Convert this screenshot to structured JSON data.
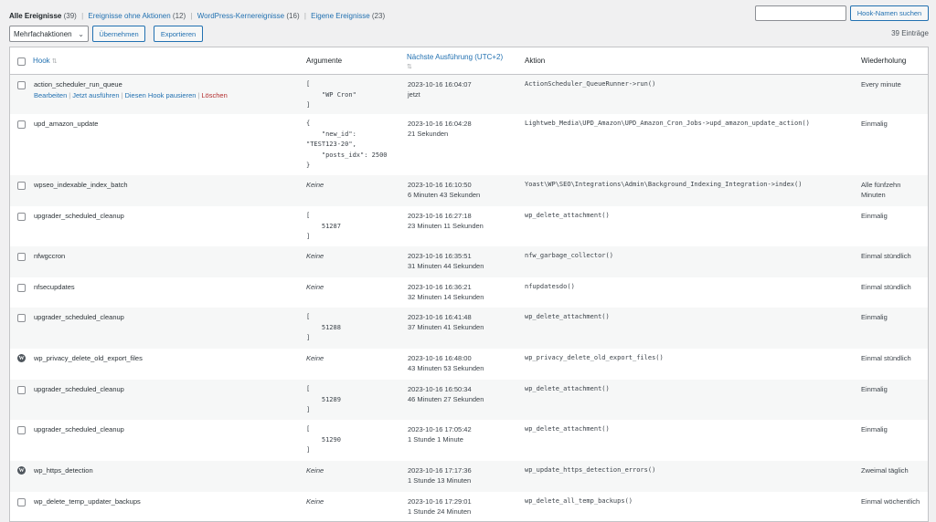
{
  "filters": {
    "all_label": "Alle Ereignisse",
    "all_count": "(39)",
    "noaction_label": "Ereignisse ohne Aktionen",
    "noaction_count": "(12)",
    "core_label": "WordPress-Kernereignisse",
    "core_count": "(16)",
    "custom_label": "Eigene Ereignisse",
    "custom_count": "(23)"
  },
  "search": {
    "input_value": "",
    "button_label": "Hook-Namen suchen"
  },
  "toolbar": {
    "bulk_label": "Mehrfachaktionen",
    "apply_label": "Übernehmen",
    "export_label": "Exportieren",
    "item_count": "39 Einträge"
  },
  "columns": {
    "hook": "Hook",
    "args": "Argumente",
    "next": "Nächste Ausführung (UTC+2)",
    "action": "Aktion",
    "recurrence": "Wiederholung"
  },
  "row_actions": {
    "edit": "Bearbeiten",
    "run": "Jetzt ausführen",
    "pause": "Diesen Hook pausieren",
    "delete": "Löschen"
  },
  "rows": [
    {
      "hook": "action_scheduler_run_queue",
      "args": "[\n    \"WP Cron\"\n]",
      "next_date": "2023-10-16 16:04:07",
      "next_rel": "jetzt",
      "action": "ActionScheduler_QueueRunner->run()",
      "recurrence": "Every minute"
    },
    {
      "hook": "upd_amazon_update",
      "args": "{\n    \"new_id\":\n\"TEST123-20\",\n    \"posts_idx\": 2500\n}",
      "next_date": "2023-10-16 16:04:28",
      "next_rel": "21 Sekunden",
      "action": "Lightweb_Media\\UPD_Amazon\\UPD_Amazon_Cron_Jobs->upd_amazon_update_action()",
      "recurrence": "Einmalig"
    },
    {
      "hook": "wpseo_indexable_index_batch",
      "args": "Keine",
      "next_date": "2023-10-16 16:10:50",
      "next_rel": "6 Minuten 43 Sekunden",
      "action": "Yoast\\WP\\SEO\\Integrations\\Admin\\Background_Indexing_Integration->index()",
      "recurrence": "Alle fünfzehn Minuten"
    },
    {
      "hook": "upgrader_scheduled_cleanup",
      "args": "[\n    51287\n]",
      "next_date": "2023-10-16 16:27:18",
      "next_rel": "23 Minuten 11 Sekunden",
      "action": "wp_delete_attachment()",
      "recurrence": "Einmalig"
    },
    {
      "hook": "nfwgccron",
      "args": "Keine",
      "next_date": "2023-10-16 16:35:51",
      "next_rel": "31 Minuten 44 Sekunden",
      "action": "nfw_garbage_collector()",
      "recurrence": "Einmal stündlich"
    },
    {
      "hook": "nfsecupdates",
      "args": "Keine",
      "next_date": "2023-10-16 16:36:21",
      "next_rel": "32 Minuten 14 Sekunden",
      "action": "nfupdatesdo()",
      "recurrence": "Einmal stündlich"
    },
    {
      "hook": "upgrader_scheduled_cleanup",
      "args": "[\n    51288\n]",
      "next_date": "2023-10-16 16:41:48",
      "next_rel": "37 Minuten 41 Sekunden",
      "action": "wp_delete_attachment()",
      "recurrence": "Einmalig"
    },
    {
      "hook": "wp_privacy_delete_old_export_files",
      "args": "Keine",
      "next_date": "2023-10-16 16:48:00",
      "next_rel": "43 Minuten 53 Sekunden",
      "action": "wp_privacy_delete_old_export_files()",
      "recurrence": "Einmal stündlich"
    },
    {
      "hook": "upgrader_scheduled_cleanup",
      "args": "[\n    51289\n]",
      "next_date": "2023-10-16 16:50:34",
      "next_rel": "46 Minuten 27 Sekunden",
      "action": "wp_delete_attachment()",
      "recurrence": "Einmalig"
    },
    {
      "hook": "upgrader_scheduled_cleanup",
      "args": "[\n    51290\n]",
      "next_date": "2023-10-16 17:05:42",
      "next_rel": "1 Stunde 1 Minute",
      "action": "wp_delete_attachment()",
      "recurrence": "Einmalig"
    },
    {
      "hook": "wp_https_detection",
      "args": "Keine",
      "next_date": "2023-10-16 17:17:36",
      "next_rel": "1 Stunde 13 Minuten",
      "action": "wp_update_https_detection_errors()",
      "recurrence": "Zweimal täglich"
    },
    {
      "hook": "wp_delete_temp_updater_backups",
      "args": "Keine",
      "next_date": "2023-10-16 17:29:01",
      "next_rel": "1 Stunde 24 Minuten",
      "action": "wp_delete_all_temp_backups()",
      "recurrence": "Einmal wöchentlich"
    }
  ],
  "icons": {
    "checkbox": "checkbox-icon",
    "wordpress": "wordpress-logo-icon",
    "sort": "sort-arrows-icon",
    "chevron": "chevron-down-icon"
  }
}
